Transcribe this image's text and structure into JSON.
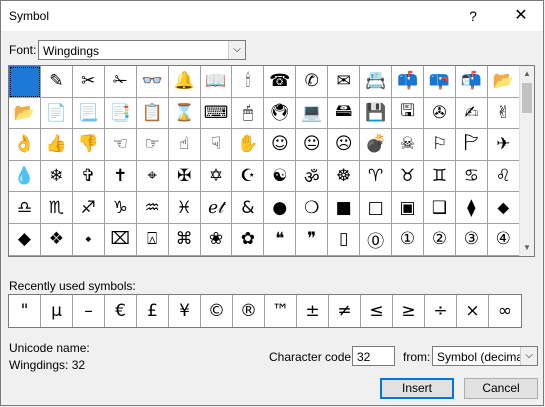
{
  "window": {
    "title": "Symbol",
    "help_glyph": "?",
    "close_glyph": "✕"
  },
  "font": {
    "label": "Font:",
    "value": "Wingdings",
    "arrow": "⌵"
  },
  "grid": {
    "rows": [
      [
        "",
        "✎",
        "✂",
        "✁",
        "👓",
        "🔔",
        "📖",
        "🕯",
        "☎",
        "✆",
        "✉",
        "📇",
        "📫",
        "📪",
        "📬",
        "📂"
      ],
      [
        "📂",
        "📄",
        "📃",
        "📑",
        "📋",
        "⌛",
        "⌨",
        "🖱",
        "🖲",
        "💻",
        "🖴",
        "💾",
        "🖫",
        "✇",
        "✍",
        "✌"
      ],
      [
        "👌",
        "👍",
        "👎",
        "☜",
        "☞",
        "☝",
        "☟",
        "✋",
        "☺",
        "😐",
        "☹",
        "💣",
        "☠",
        "⚐",
        "🏱",
        "✈"
      ],
      [
        "💧",
        "❄",
        "✞",
        "✝",
        "⌖",
        "✠",
        "✡",
        "☪",
        "☯",
        "ॐ",
        "☸",
        "♈",
        "♉",
        "♊",
        "♋",
        "♌"
      ],
      [
        "♎",
        "♏",
        "♐",
        "♑",
        "♒",
        "♓",
        "ℯ𝓉",
        "&",
        "●",
        "❍",
        "■",
        "□",
        "▣",
        "❑",
        "⧫",
        "⬥"
      ],
      [
        "◆",
        "❖",
        "⬩",
        "⌧",
        "⍓",
        "⌘",
        "❀",
        "✿",
        "❝",
        "❞",
        "▯",
        "⓪",
        "①",
        "②",
        "③",
        "④"
      ]
    ],
    "scroll_up": "▲",
    "scroll_down": "▼"
  },
  "recent": {
    "label": "Recently used symbols:",
    "symbols": [
      "\"",
      "μ",
      "–",
      "€",
      "£",
      "¥",
      "©",
      "®",
      "™",
      "±",
      "≠",
      "≤",
      "≥",
      "÷",
      "×",
      "∞"
    ]
  },
  "unicode": {
    "label": "Unicode name:",
    "value": "Wingdings: 32"
  },
  "char_code": {
    "label": "Character code:",
    "value": "32"
  },
  "from": {
    "label": "from:",
    "value": "Symbol (decimal)",
    "arrow": "⌵"
  },
  "buttons": {
    "insert": "Insert",
    "cancel": "Cancel"
  },
  "colors": {
    "selection": "#1e78d7",
    "default_button_border": "#0078d7"
  }
}
